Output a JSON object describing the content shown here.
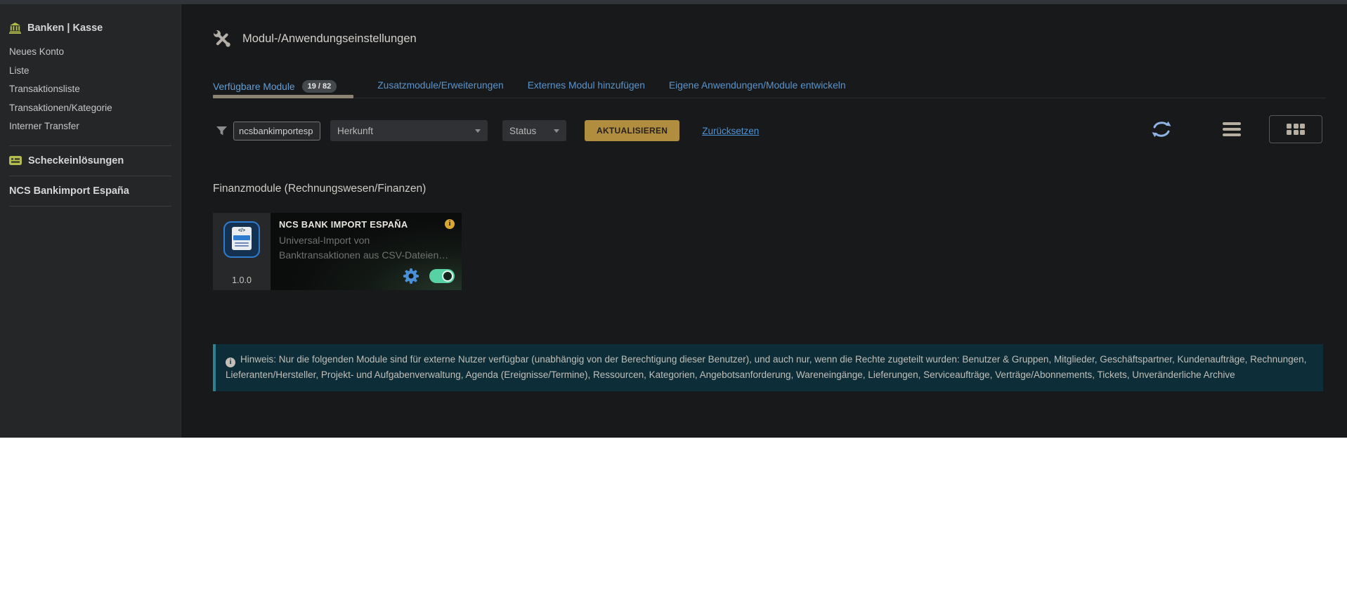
{
  "colors": {
    "top_strip": "#31353a",
    "sidebar_bg": "#242628",
    "content_bg": "#18191b",
    "accent_blue": "#5b94cb",
    "link_blue": "#4f93d2",
    "button_gold": "#b18e3f",
    "tab_underline": "#8d8374",
    "sidebar_icon_yellow": "#b3bc4c",
    "toggle_green": "#58d2a4",
    "gear_blue": "#4a90d9",
    "info_badge_gold": "#d9a72f",
    "notice_bg": "#0d2d39",
    "notice_border": "#2e8093",
    "module_icon_blue": "#2e7cd0"
  },
  "sidebar": {
    "section_title": "Banken | Kasse",
    "items": [
      "Neues Konto",
      "Liste",
      "Transaktionsliste",
      "Transaktionen/Kategorie",
      "Interner Transfer"
    ],
    "checks_title": "Scheckeinlösungen",
    "module_title": "NCS Bankimport España"
  },
  "header": {
    "title": "Modul-/Anwendungseinstellungen"
  },
  "tabs": {
    "active": {
      "label": "Verfügbare Module",
      "badge": "19 / 82"
    },
    "others": [
      "Zusatzmodule/Erweiterungen",
      "Externes Modul hinzufügen",
      "Eigene Anwendungen/Module entwickeln"
    ]
  },
  "filterbar": {
    "search_value": "ncsbankimportesp",
    "origin_label": "Herkunft",
    "status_label": "Status",
    "update_label": "AKTUALISIEREN",
    "reset_label": "Zurücksetzen"
  },
  "section": {
    "title": "Finanzmodule (Rechnungswesen/Finanzen)"
  },
  "module_card": {
    "version": "1.0.0",
    "title": "NCS BANK IMPORT ESPAÑA",
    "description": "Universal-Import von Banktransaktionen aus CSV-Dateien…",
    "icon_code": "</>",
    "info_glyph": "i",
    "enabled": true
  },
  "notice": {
    "glyph": "i",
    "text": "Hinweis: Nur die folgenden Module sind für externe Nutzer verfügbar (unabhängig von der Berechtigung dieser Benutzer), und auch nur, wenn die Rechte zugeteilt wurden: Benutzer & Gruppen, Mitglieder, Geschäftspartner, Kundenaufträge, Rechnungen, Lieferanten/Hersteller, Projekt- und Aufgabenverwaltung, Agenda (Ereignisse/Termine), Ressourcen, Kategorien, Angebotsanforderung, Wareneingänge, Lieferungen, Serviceaufträge, Verträge/Abonnements, Tickets, Unveränderliche Archive"
  }
}
